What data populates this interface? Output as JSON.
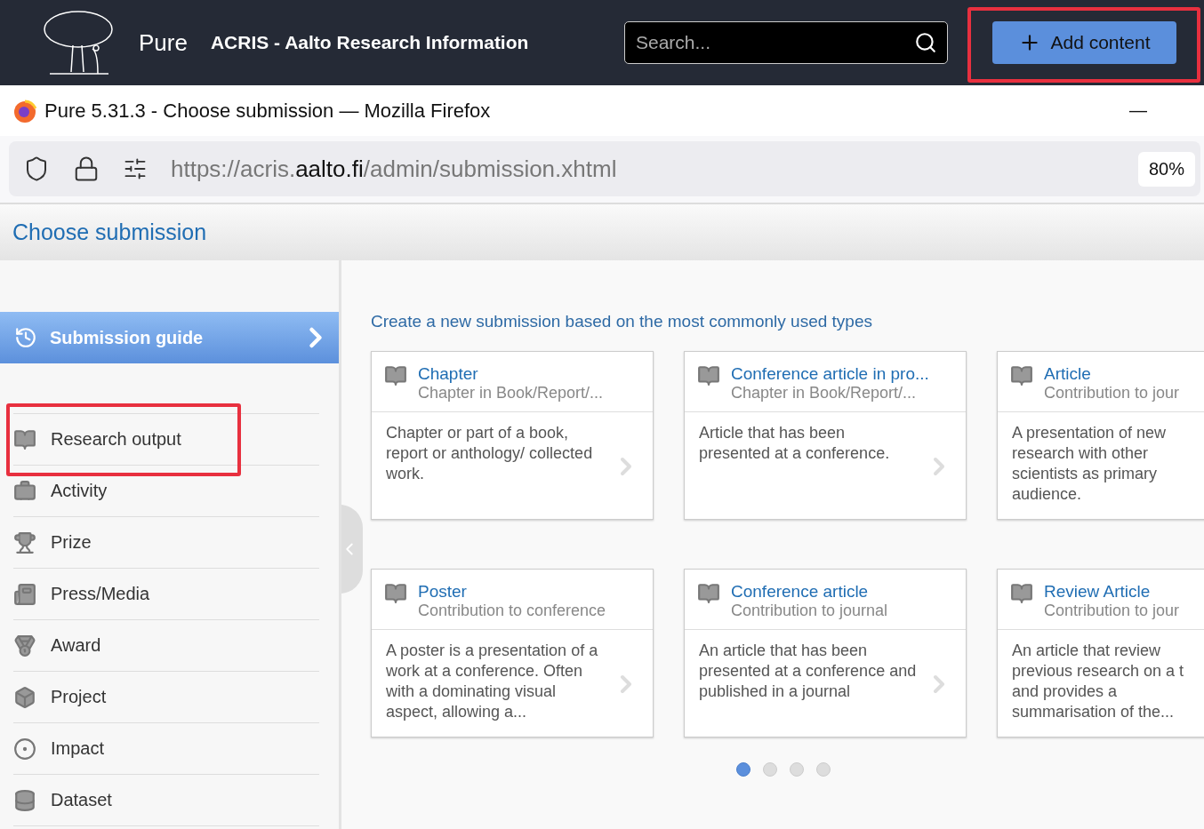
{
  "app_bar": {
    "product": "Pure",
    "site_title": "ACRIS - Aalto Research Information",
    "search": {
      "placeholder": "Search..."
    },
    "add_button": "Add content",
    "add_button_highlighted": true
  },
  "browser": {
    "window_title": "Pure 5.31.3 - Choose submission — Mozilla Firefox",
    "minimize": "—",
    "url_prefix": "https://acris.",
    "url_domain": "aalto.fi",
    "url_path": "/admin/submission.xhtml",
    "zoom": "80%"
  },
  "page_header": {
    "title": "Choose submission"
  },
  "sidebar": {
    "guide": "Submission guide",
    "items": [
      {
        "label": "Research output",
        "highlighted": true
      },
      {
        "label": "Activity",
        "highlighted": false
      },
      {
        "label": "Prize",
        "highlighted": false
      },
      {
        "label": "Press/Media",
        "highlighted": false
      },
      {
        "label": "Award",
        "highlighted": false
      },
      {
        "label": "Project",
        "highlighted": false
      },
      {
        "label": "Impact",
        "highlighted": false
      },
      {
        "label": "Dataset",
        "highlighted": false
      }
    ]
  },
  "content": {
    "heading": "Create a new submission based on the most commonly used types",
    "cards": [
      {
        "title": "Chapter",
        "subtitle": "Chapter in Book/Report/...",
        "description": "Chapter or part of a book, report or anthology/ collected work.",
        "cut": false
      },
      {
        "title": "Conference article in pro...",
        "subtitle": "Chapter in Book/Report/...",
        "description": "Article that has been presented at a conference.",
        "cut": false
      },
      {
        "title": "Article",
        "subtitle": "Contribution to jour",
        "description": "A presentation of new research with other scientists as primary audience.",
        "cut": true
      },
      {
        "title": "Poster",
        "subtitle": "Contribution to conference",
        "description": "A poster is a presentation of a work at a conference. Often with a dominating visual aspect, allowing a...",
        "cut": false
      },
      {
        "title": "Conference article",
        "subtitle": "Contribution to journal",
        "description": "An article that has been presented at a conference and published in a journal",
        "cut": false
      },
      {
        "title": "Review Article",
        "subtitle": "Contribution to jour",
        "description": "An article that review previous research on a t and provides a summarisation of the...",
        "cut": true
      }
    ],
    "pages": [
      {
        "selected": true
      },
      {
        "selected": false
      },
      {
        "selected": false
      },
      {
        "selected": false
      }
    ]
  }
}
